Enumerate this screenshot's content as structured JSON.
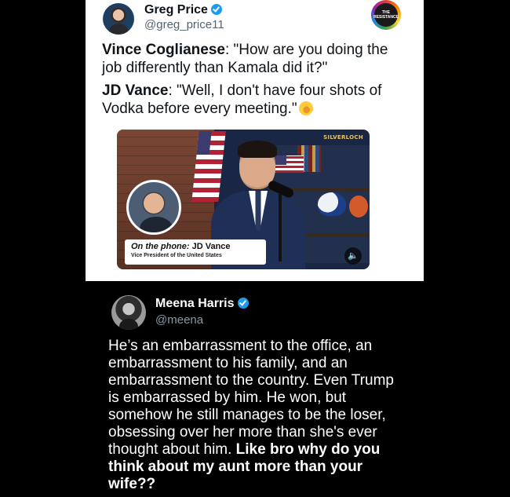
{
  "tweet_top": {
    "author_name": "Greg Price",
    "author_handle": "@greg_price11",
    "verified": true,
    "badge_logo_text": "THE RESISTANCE",
    "quote1_speaker": "Vince Coglianese",
    "quote1_text": ": \"How are you doing the job differently than Kamala did it?\"",
    "quote2_speaker": "JD Vance",
    "quote2_text": ": \"Well, I don't have four shots of Vodka before every meeting.\"",
    "emoji": "rolling-on-floor-laughing-emoji",
    "video": {
      "lower_third_prefix": "On the phone:",
      "lower_third_name": " JD Vance",
      "lower_third_title": "Vice President of the United States",
      "watermark": "SILVERLOCH",
      "mute_icon": "🔈"
    }
  },
  "tweet_bottom": {
    "author_name": "Meena Harris",
    "author_handle": "@meena",
    "verified": true,
    "body_regular": "He’s an embarrassment to the office, an embarrassment to his family, and an embarrassment to the country. Even Trump is embarrassed by him. He won, but somehow he still manages to be the loser, obsessing over her more than she's ever thought about him. ",
    "body_bold": "Like bro why do you think about my aunt more than your wife??"
  },
  "colors": {
    "verified_blue": "#1d9bf0",
    "page_background": "#000000",
    "card_background": "#ffffff",
    "handle_gray_light": "#536471",
    "handle_gray_dark": "#8b98a5"
  }
}
